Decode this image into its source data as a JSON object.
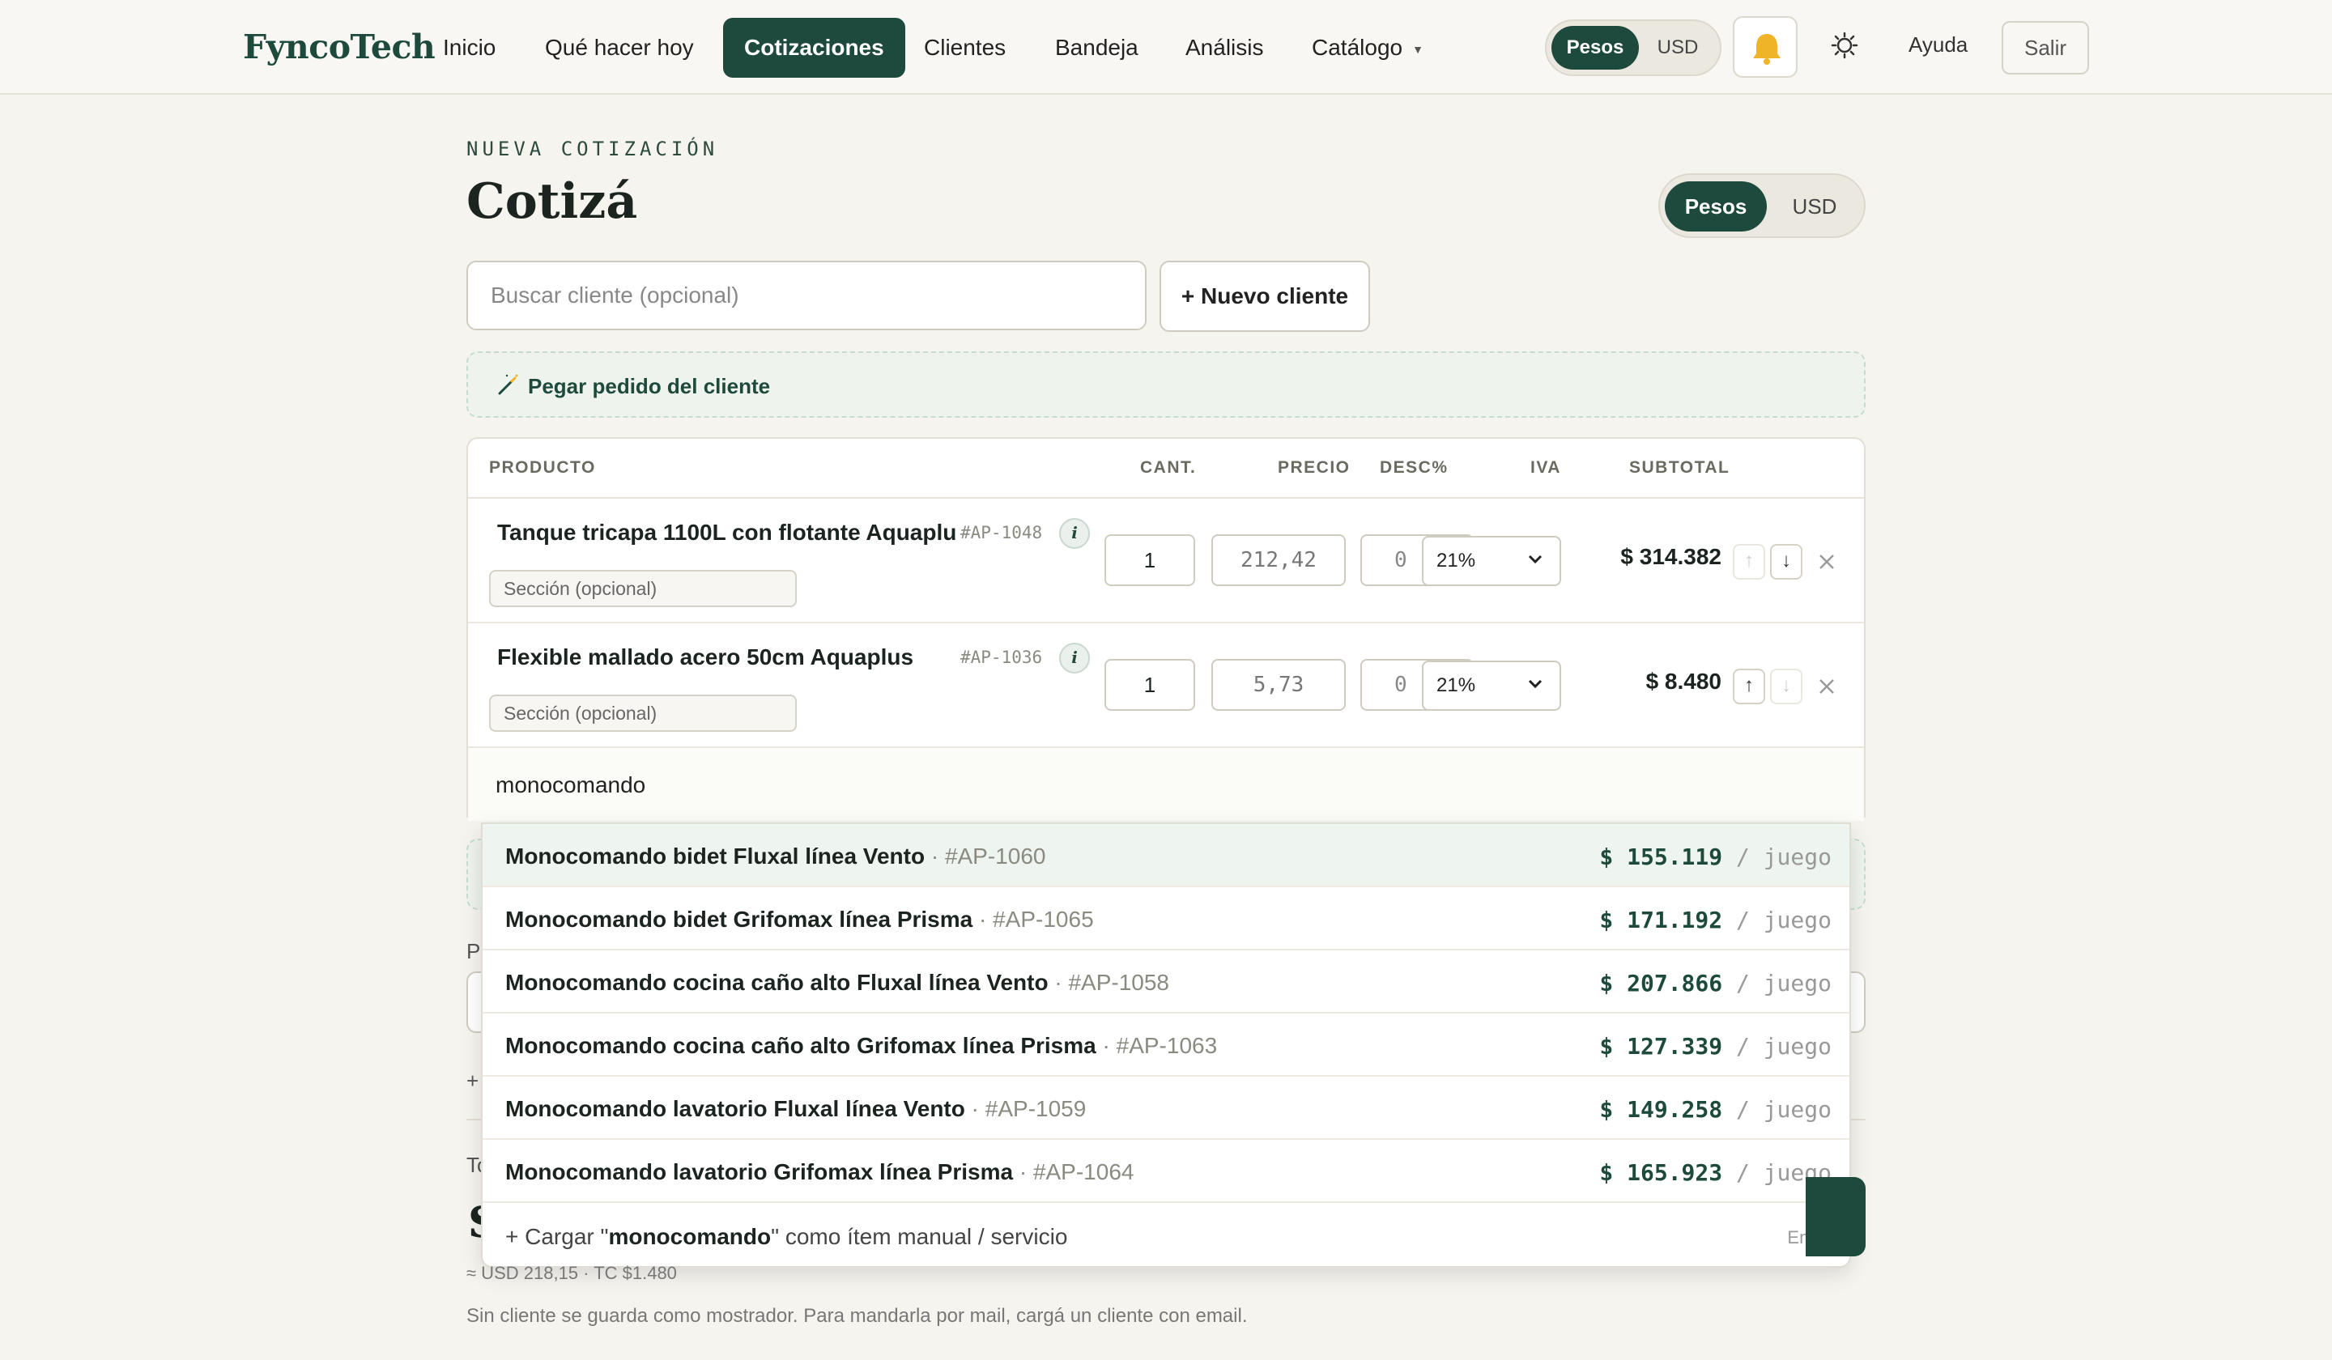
{
  "nav": {
    "brand": "FyncoTech",
    "items": [
      {
        "label": "Inicio"
      },
      {
        "label": "Qué hacer hoy"
      },
      {
        "label": "Cotizaciones",
        "active": true
      },
      {
        "label": "Clientes"
      },
      {
        "label": "Bandeja"
      },
      {
        "label": "Análisis"
      },
      {
        "label": "Catálogo"
      }
    ],
    "currency": {
      "pesos": "Pesos",
      "usd": "USD",
      "selected": "Pesos"
    },
    "help": "Ayuda",
    "logout": "Salir"
  },
  "page": {
    "eyebrow": "NUEVA COTIZACIÓN",
    "title": "Cotizá",
    "currency": {
      "pesos": "Pesos",
      "usd": "USD",
      "selected": "Pesos"
    }
  },
  "client": {
    "search_placeholder": "Buscar cliente (opcional)",
    "new_client": "+ Nuevo cliente"
  },
  "paste_order": {
    "label": "Pegar pedido del cliente"
  },
  "table": {
    "headers": {
      "product": "PRODUCTO",
      "qty": "CANT.",
      "price": "PRECIO",
      "discount": "DESC%",
      "iva": "IVA",
      "subtotal": "SUBTOTAL"
    },
    "rows": [
      {
        "name": "Tanque tricapa 1100L con flotante Aquaplu",
        "sku": "#AP-1048",
        "section_placeholder": "Sección (opcional)",
        "qty": "1",
        "price": "212,42",
        "discount": "0",
        "iva": "21%",
        "subtotal": "$ 314.382"
      },
      {
        "name": "Flexible mallado acero 50cm Aquaplus",
        "sku": "#AP-1036",
        "section_placeholder": "Sección (opcional)",
        "qty": "1",
        "price": "5,73",
        "discount": "0",
        "iva": "21%",
        "subtotal": "$ 8.480"
      }
    ],
    "search_value": "monocomando"
  },
  "dropdown": {
    "options": [
      {
        "name": "Monocomando bidet Fluxal línea Vento",
        "sku": "#AP-1060",
        "price": "$ 155.119",
        "unit": "/ juego"
      },
      {
        "name": "Monocomando bidet Grifomax línea Prisma",
        "sku": "#AP-1065",
        "price": "$ 171.192",
        "unit": "/ juego"
      },
      {
        "name": "Monocomando cocina caño alto Fluxal línea Vento",
        "sku": "#AP-1058",
        "price": "$ 207.866",
        "unit": "/ juego"
      },
      {
        "name": "Monocomando cocina caño alto Grifomax línea Prisma",
        "sku": "#AP-1063",
        "price": "$ 127.339",
        "unit": "/ juego"
      },
      {
        "name": "Monocomando lavatorio Fluxal línea Vento",
        "sku": "#AP-1059",
        "price": "$ 149.258",
        "unit": "/ juego"
      },
      {
        "name": "Monocomando lavatorio Grifomax línea Prisma",
        "sku": "#AP-1064",
        "price": "$ 165.923",
        "unit": "/ juego"
      }
    ],
    "manual": {
      "prefix": "+ Cargar \"",
      "term": "monocomando",
      "suffix": "\" como ítem manual / servicio",
      "hint": "Enter"
    }
  },
  "footer": {
    "usd_equiv": "≈ USD 218,15 · TC $1.480",
    "note": "Sin cliente se guarda como mostrador. Para mandarla por mail, cargá un cliente con email."
  },
  "colors": {
    "accent": "#1d4a3c",
    "background": "#f6f4ef",
    "bell": "#f0b429"
  }
}
